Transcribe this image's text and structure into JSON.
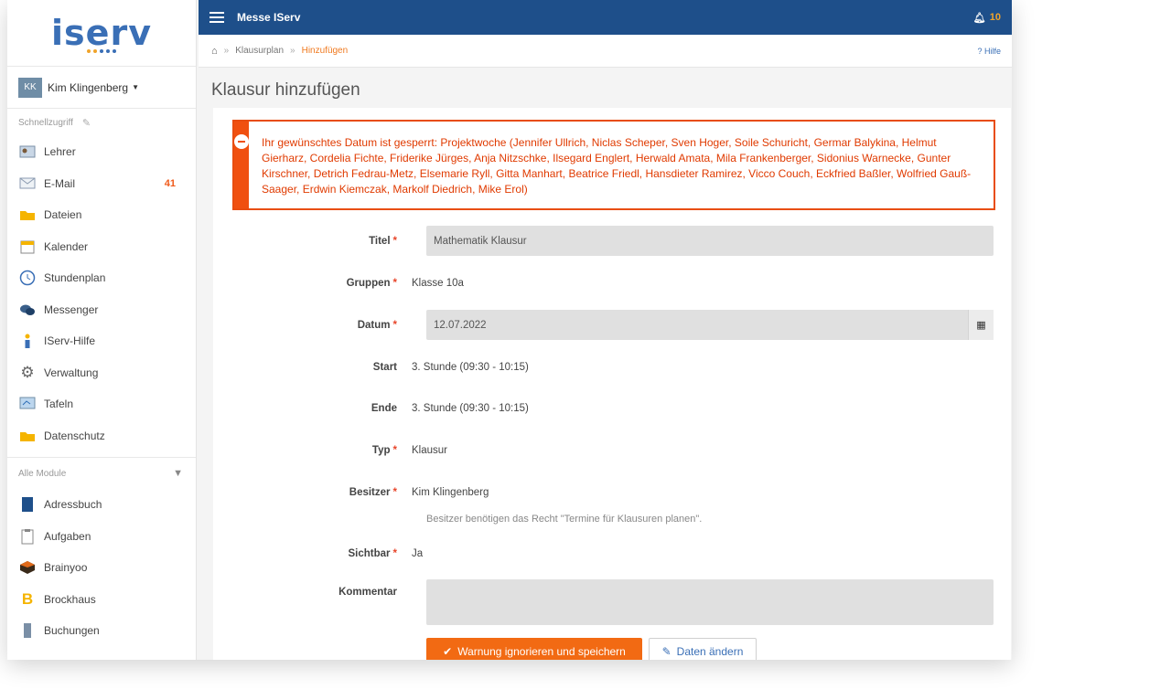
{
  "sidebar": {
    "logo": "iserv",
    "user": {
      "initials": "KK",
      "name": "Kim Klingenberg"
    },
    "quick_access_label": "Schnellzugriff",
    "quick_items": [
      {
        "label": "Lehrer",
        "icon": "teacher-icon"
      },
      {
        "label": "E-Mail",
        "icon": "mail-icon",
        "badge": "41"
      },
      {
        "label": "Dateien",
        "icon": "folder-icon"
      },
      {
        "label": "Kalender",
        "icon": "calendar-icon"
      },
      {
        "label": "Stundenplan",
        "icon": "clock-icon"
      },
      {
        "label": "Messenger",
        "icon": "chat-icon"
      },
      {
        "label": "IServ-Hilfe",
        "icon": "help-icon"
      },
      {
        "label": "Verwaltung",
        "icon": "gear-icon"
      },
      {
        "label": "Tafeln",
        "icon": "board-icon"
      },
      {
        "label": "Datenschutz",
        "icon": "folder-icon"
      }
    ],
    "all_modules_label": "Alle Module",
    "module_items": [
      {
        "label": "Adressbuch",
        "icon": "address-book-icon"
      },
      {
        "label": "Aufgaben",
        "icon": "clipboard-icon"
      },
      {
        "label": "Brainyoo",
        "icon": "brainyoo-icon"
      },
      {
        "label": "Brockhaus",
        "icon": "brockhaus-icon"
      },
      {
        "label": "Buchungen",
        "icon": "booking-icon"
      }
    ]
  },
  "topbar": {
    "title": "Messe IServ",
    "notifications": "10"
  },
  "breadcrumb": {
    "items": [
      "Klausurplan",
      "Hinzufügen"
    ],
    "help": "Hilfe"
  },
  "page": {
    "title": "Klausur hinzufügen"
  },
  "alert": {
    "text": "Ihr gewünschtes Datum ist gesperrt: Projektwoche (Jennifer Ullrich, Niclas Scheper, Sven Hoger, Soile Schuricht, Germar Balykina, Helmut Gierharz, Cordelia Fichte, Friderike Jürges, Anja Nitzschke, Ilsegard Englert, Herwald Amata, Mila Frankenberger, Sidonius Warnecke, Gunter Kirschner, Detrich Fedrau-Metz, Elsemarie Ryll, Gitta Manhart, Beatrice Friedl, Hansdieter Ramirez, Vicco Couch, Eckfried Baßler, Wolfried Gauß-Saager, Erdwin Kiemczak, Markolf Diedrich, Mike Erol)"
  },
  "form": {
    "titel": {
      "label": "Titel",
      "value": "Mathematik Klausur"
    },
    "gruppen": {
      "label": "Gruppen",
      "value": "Klasse 10a"
    },
    "datum": {
      "label": "Datum",
      "value": "12.07.2022"
    },
    "start": {
      "label": "Start",
      "value": "3. Stunde (09:30 - 10:15)"
    },
    "ende": {
      "label": "Ende",
      "value": "3. Stunde (09:30 - 10:15)"
    },
    "typ": {
      "label": "Typ",
      "value": "Klausur"
    },
    "besitzer": {
      "label": "Besitzer",
      "value": "Kim Klingenberg",
      "hint": "Besitzer benötigen das Recht \"Termine für Klausuren planen\"."
    },
    "sichtbar": {
      "label": "Sichtbar",
      "value": "Ja"
    },
    "kommentar": {
      "label": "Kommentar",
      "value": ""
    }
  },
  "buttons": {
    "save": "Warnung ignorieren und speichern",
    "edit": "Daten ändern"
  },
  "colors": {
    "accent": "#f26a13",
    "topbar": "#1e4f8a",
    "alert": "#e84d10",
    "link": "#3a6fb6"
  }
}
